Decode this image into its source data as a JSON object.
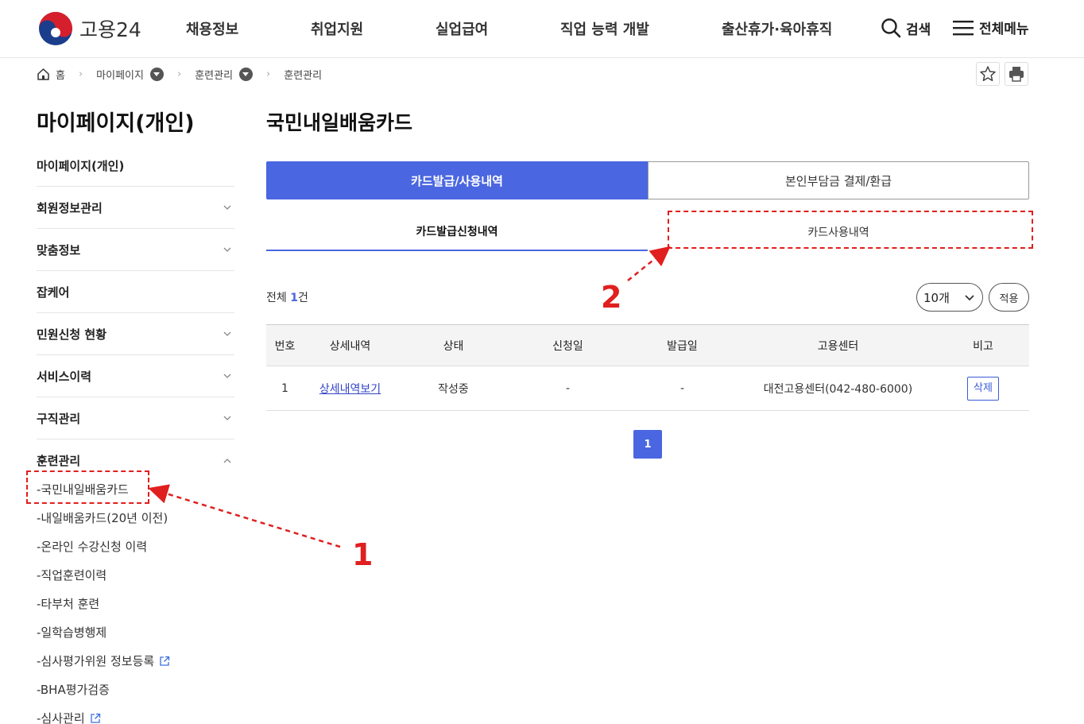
{
  "header": {
    "logo_text": "고용24",
    "nav": [
      "채용정보",
      "취업지원",
      "실업급여",
      "직업 능력 개발",
      "출산휴가·육아휴직"
    ],
    "search_label": "검색",
    "menu_label": "전체메뉴"
  },
  "breadcrumb": {
    "home": "홈",
    "level1": "마이페이지",
    "level2": "훈련관리",
    "level3": "훈련관리"
  },
  "sidebar": {
    "title": "마이페이지(개인)",
    "items": [
      {
        "label": "마이페이지(개인)",
        "expandable": false
      },
      {
        "label": "회원정보관리",
        "expandable": true
      },
      {
        "label": "맞춤정보",
        "expandable": true
      },
      {
        "label": "잡케어",
        "expandable": false
      },
      {
        "label": "민원신청 현황",
        "expandable": true
      },
      {
        "label": "서비스이력",
        "expandable": true
      },
      {
        "label": "구직관리",
        "expandable": true
      },
      {
        "label": "훈련관리",
        "expandable": true,
        "open": true
      }
    ],
    "sub_items": [
      {
        "label": "-국민내일배움카드",
        "external": false
      },
      {
        "label": "-내일배움카드(20년 이전)",
        "external": false
      },
      {
        "label": "-온라인 수강신청 이력",
        "external": false
      },
      {
        "label": "-직업훈련이력",
        "external": false
      },
      {
        "label": "-타부처 훈련",
        "external": false
      },
      {
        "label": "-일학습병행제",
        "external": false
      },
      {
        "label": "-심사평가위원 정보등록",
        "external": true
      },
      {
        "label": "-BHA평가검증",
        "external": false
      },
      {
        "label": "-심사관리",
        "external": true
      }
    ]
  },
  "main": {
    "title": "국민내일배움카드",
    "tabs": [
      {
        "label": "카드발급/사용내역",
        "active": true
      },
      {
        "label": "본인부담금 결제/환급",
        "active": false
      }
    ],
    "subtabs": [
      {
        "label": "카드발급신청내역",
        "active": true
      },
      {
        "label": "카드사용내역",
        "active": false
      }
    ],
    "total_prefix": "전체",
    "total_count": "1",
    "total_suffix": "건",
    "page_size": "10개",
    "apply_label": "적용",
    "table": {
      "headers": [
        "번호",
        "상세내역",
        "상태",
        "신청일",
        "발급일",
        "고용센터",
        "비고"
      ],
      "rows": [
        {
          "no": "1",
          "detail": "상세내역보기",
          "status": "작성중",
          "apply_date": "-",
          "issue_date": "-",
          "center": "대전고용센터(042-480-6000)",
          "action": "삭제"
        }
      ]
    },
    "pagination": {
      "current": "1"
    }
  },
  "annotations": {
    "step1": "1",
    "step2": "2",
    "color": "#e01f1f"
  },
  "colors": {
    "accent": "#4a66e0",
    "link": "#3344c8"
  }
}
